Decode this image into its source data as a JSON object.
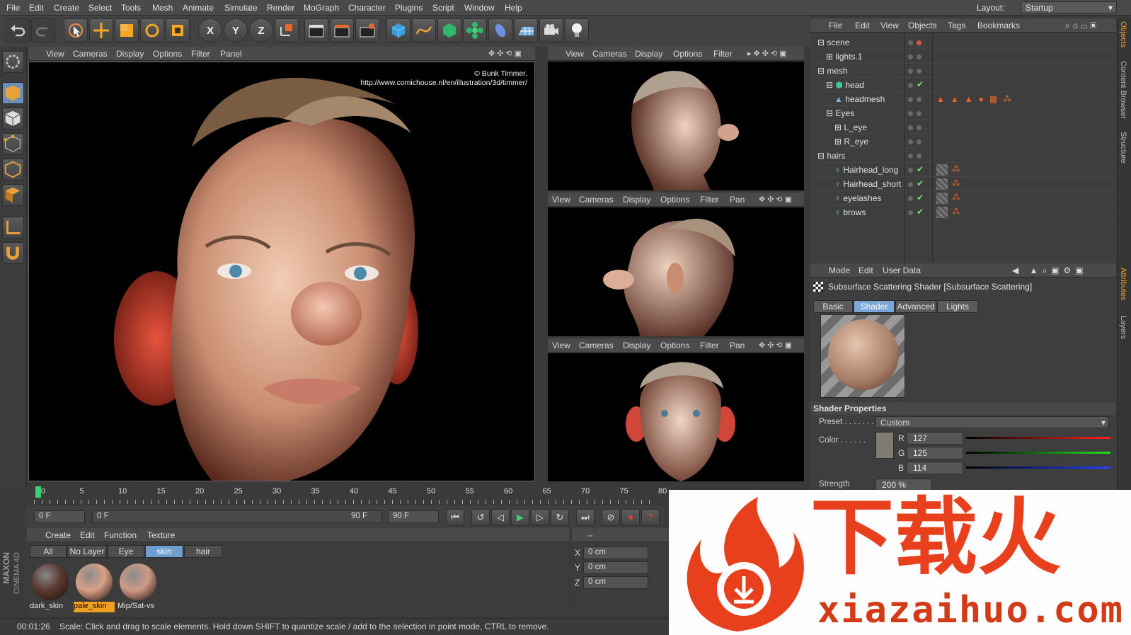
{
  "menu": [
    "File",
    "Edit",
    "Create",
    "Select",
    "Tools",
    "Mesh",
    "Animate",
    "Simulate",
    "Render",
    "MoGraph",
    "Character",
    "Plugins",
    "Script",
    "Window",
    "Help"
  ],
  "layout": {
    "label": "Layout:",
    "value": "Startup"
  },
  "toolbar": {
    "x": "X",
    "y": "Y",
    "z": "Z"
  },
  "viewport_menu_main": [
    "View",
    "Cameras",
    "Display",
    "Options",
    "Filter",
    "Panel"
  ],
  "viewport_menu_top": [
    "View",
    "Cameras",
    "Display",
    "Options",
    "Filter"
  ],
  "viewport_menu_small": [
    "View",
    "Cameras",
    "Display",
    "Options",
    "Filter",
    "Pan"
  ],
  "credit": {
    "line1": "© Bunk Timmer.",
    "line2": "http://www.comichouse.nl/en/illustration/3d/timmer/"
  },
  "object_manager": {
    "menu": [
      "File",
      "Edit",
      "View",
      "Objects",
      "Tags",
      "Bookmarks"
    ],
    "rows": [
      {
        "name": "scene"
      },
      {
        "name": "lights.1"
      },
      {
        "name": "mesh"
      },
      {
        "name": "head"
      },
      {
        "name": "headmesh"
      },
      {
        "name": "Eyes"
      },
      {
        "name": "L_eye"
      },
      {
        "name": "R_eye"
      },
      {
        "name": "hairs"
      },
      {
        "name": "Hairhead_long"
      },
      {
        "name": "Hairhead_short"
      },
      {
        "name": "eyelashes"
      },
      {
        "name": "brows"
      }
    ]
  },
  "side_tabs": [
    "Objects",
    "Content Browser",
    "Structure",
    "Attributes",
    "Layers"
  ],
  "attributes": {
    "menu": [
      "Mode",
      "Edit",
      "User Data"
    ],
    "title": "Subsurface Scattering Shader [Subsurface Scattering]",
    "tabs": [
      "Basic",
      "Shader",
      "Advanced",
      "Lights"
    ],
    "active_tab": "Shader",
    "section": "Shader Properties",
    "preset_label": "Preset . . . . . . . . .",
    "preset_value": "Custom",
    "color_label": "Color . . . . . .",
    "r_label": "R",
    "r": "127",
    "g_label": "G",
    "g": "125",
    "b_label": "B",
    "b": "114",
    "strength_label": "Strength",
    "strength_value": "200 %",
    "swatch": "#7f7d72"
  },
  "timeline": {
    "ticks": [
      "0",
      "5",
      "10",
      "15",
      "20",
      "25",
      "30",
      "35",
      "40",
      "45",
      "50",
      "55",
      "60",
      "65",
      "70",
      "75",
      "80"
    ]
  },
  "transport": {
    "current": "0 F",
    "start": "0 F",
    "end_inner": "90 F",
    "end": "90 F"
  },
  "materials": {
    "menu": [
      "Create",
      "Edit",
      "Function",
      "Texture"
    ],
    "filters": [
      "All",
      "No Layer",
      "Eye",
      "skin",
      "hair"
    ],
    "active_filter": "skin",
    "items": [
      {
        "name": "dark_skin",
        "color": "#5b3a30"
      },
      {
        "name": "pale_skin",
        "color": "#d9a088"
      },
      {
        "name": "Mip/Sat-vs",
        "color": "#cf9a86"
      }
    ]
  },
  "coordinates": {
    "header": "--",
    "x": "X",
    "y": "Y",
    "z": "Z",
    "xv": "0 cm",
    "yv": "0 cm",
    "zv": "0 cm"
  },
  "status": {
    "time": "00:01:26",
    "text": "Scale: Click and drag to scale elements. Hold down SHIFT to quantize scale / add to the selection in point mode, CTRL to remove."
  },
  "brand": {
    "maxon": "MAXON",
    "cinema": "CINEMA 4D"
  },
  "watermark": {
    "cn": "下载火",
    "url": "xiazaihuo.com"
  }
}
